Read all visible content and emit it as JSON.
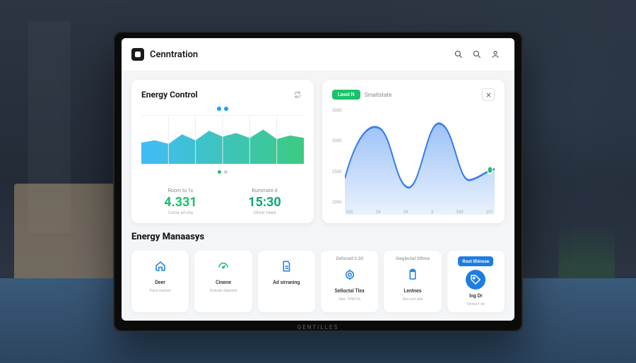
{
  "header": {
    "app_title": "Cenntration"
  },
  "energy_panel": {
    "title": "Energy Control",
    "metric_a": {
      "label": "Room to 1x",
      "value": "4.331",
      "sub": "Come ad cha"
    },
    "metric_b": {
      "label": "Kummare d",
      "value": "15:30",
      "sub": "Clime: Hees"
    }
  },
  "usage_panel": {
    "badge": "Lasol N",
    "mode": "Smaltstate"
  },
  "chart_data": {
    "energy_area": {
      "type": "area",
      "x": [
        0,
        1,
        2,
        3,
        4,
        5,
        6,
        7,
        8,
        9,
        10,
        11
      ],
      "values": [
        55,
        60,
        52,
        68,
        58,
        72,
        64,
        70,
        62,
        74,
        60,
        66
      ],
      "ylim": [
        0,
        100
      ],
      "fill_gradient": [
        "#1fb0f5",
        "#19c26b"
      ]
    },
    "usage_line": {
      "type": "line",
      "title": "Smaltstate",
      "categories": [
        "320",
        "24",
        "29",
        "3",
        "330",
        "231"
      ],
      "x": [
        320,
        340,
        360,
        380,
        400,
        420
      ],
      "values": [
        2200,
        4600,
        2000,
        4700,
        2200,
        2600
      ],
      "y_ticks": [
        5000,
        3000,
        2500,
        2000
      ],
      "ylim": [
        1500,
        5200
      ],
      "color": "#3a7ef0",
      "fill": "#cfe0fb"
    }
  },
  "section_title": "Energy Manaasys",
  "tiles": [
    {
      "head": "",
      "icon": "home",
      "label": "Deer",
      "sub": "Paca inaiton",
      "style": "outline"
    },
    {
      "head": "",
      "icon": "gauge",
      "label": "Cinene",
      "sub": "Dobute depined",
      "style": "green"
    },
    {
      "head": "",
      "icon": "document",
      "label": "Ad sirraning",
      "sub": "",
      "style": "outline"
    },
    {
      "head": "Defoned 0.30",
      "icon": "target",
      "label": "Selloctal Tlex",
      "sub": "Sea: 1FM Os",
      "style": "outline"
    },
    {
      "head": "Sieglectal Sthioe",
      "icon": "clipboard",
      "label": "Lentnes",
      "sub": "Des out ahe",
      "style": "outline"
    },
    {
      "head_badge": "Rost Ilhinose",
      "icon": "tag",
      "label": "Ing Dr",
      "sub": "Ubtoa t rie",
      "style": "filled"
    }
  ],
  "colors": {
    "accent_blue": "#1f7de0",
    "accent_green": "#19c26b"
  }
}
